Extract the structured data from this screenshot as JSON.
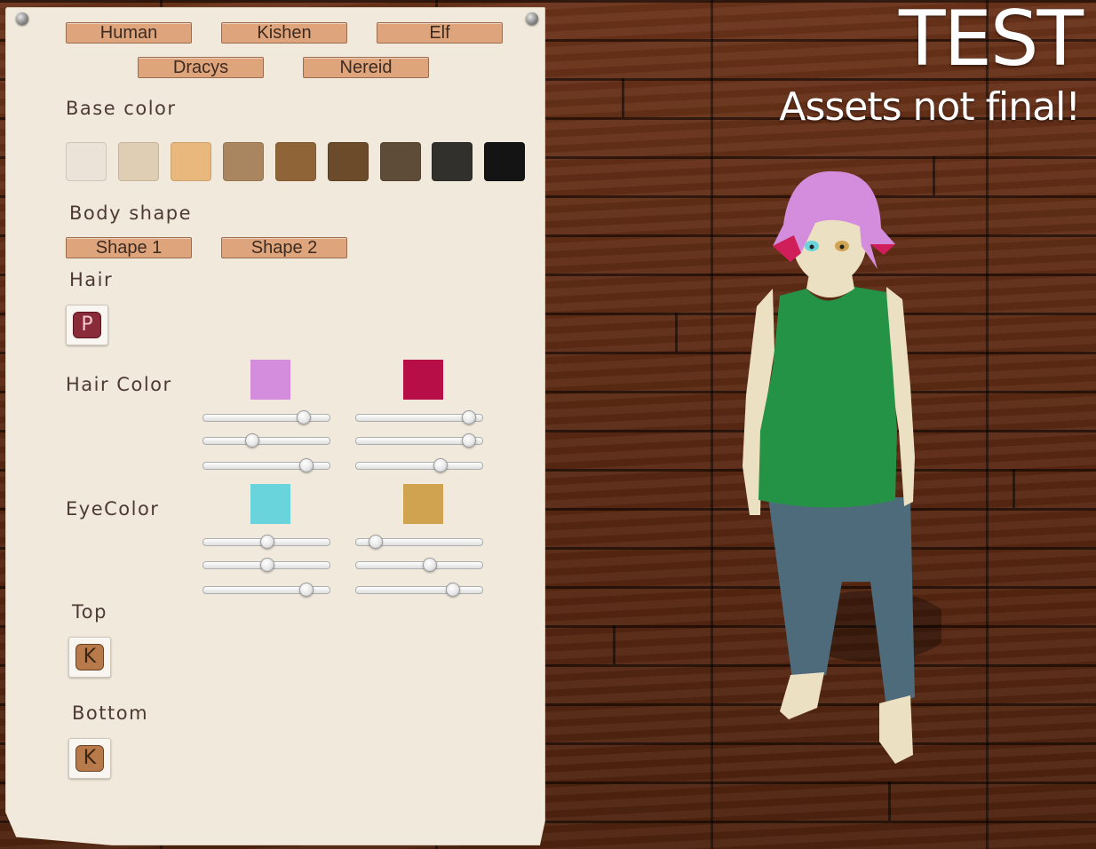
{
  "race_buttons": [
    "Human",
    "Kishen",
    "Elf",
    "Dracys",
    "Nereid"
  ],
  "base_color": {
    "heading": "Base color",
    "swatches": [
      "#ebe2d8",
      "#dfcdb4",
      "#e9b87d",
      "#a98660",
      "#8f6537",
      "#6b4b2a",
      "#5f4c38",
      "#32302c",
      "#141414"
    ]
  },
  "body_shape": {
    "heading": "Body shape",
    "shapes": [
      "Shape 1",
      "Shape 2"
    ]
  },
  "hair": {
    "heading": "Hair",
    "icon_letter": "P",
    "icon_name": "hair-style-p-icon"
  },
  "hair_color": {
    "heading": "Hair Color",
    "primary_color": "#d48ddc",
    "secondary_color": "#b70e48",
    "primary_sliders": [
      0.79,
      0.38,
      0.81
    ],
    "secondary_sliders": [
      0.89,
      0.89,
      0.66
    ]
  },
  "eye_color": {
    "heading": "EyeColor",
    "primary_color": "#6ad4dc",
    "secondary_color": "#d0a350",
    "primary_sliders": [
      0.5,
      0.5,
      0.81
    ],
    "secondary_sliders": [
      0.15,
      0.58,
      0.76
    ]
  },
  "top": {
    "heading": "Top",
    "icon_letter": "K",
    "icon_name": "top-style-k-icon"
  },
  "bottom": {
    "heading": "Bottom",
    "icon_letter": "K",
    "icon_name": "bottom-style-k-icon"
  },
  "overlay": {
    "title": "TEST",
    "subtitle": "Assets not final!"
  },
  "character_colors": {
    "skin": "#ece0c2",
    "shirt": "#249346",
    "pants": "#4d6b7b",
    "hair": "#d48ddc",
    "hair_tips": "#d01e5a"
  }
}
